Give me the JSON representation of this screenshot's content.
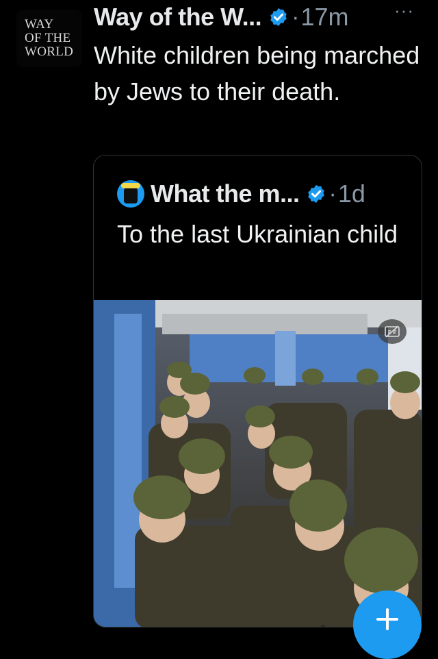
{
  "tweet": {
    "avatar_lines": [
      "WAY",
      "OF THE",
      "WORLD"
    ],
    "author_name": "Way of the W...",
    "separator": "·",
    "time": "17m",
    "more_label": "···",
    "text": "White children being marched by Jews to their death.",
    "verified_icon": "verified-badge-icon"
  },
  "quoted_tweet": {
    "author_name": "What the m...",
    "separator": "·",
    "time": "1d",
    "text": "To the last Ukrainian child",
    "media": {
      "type": "video",
      "captions_icon": "captions-off-icon"
    }
  },
  "compose_button": {
    "icon": "plus-icon"
  },
  "colors": {
    "background": "#000000",
    "text_primary": "#e7e9ea",
    "text_secondary": "#8b98a5",
    "accent": "#1d9bf0",
    "border": "#2f3336"
  }
}
